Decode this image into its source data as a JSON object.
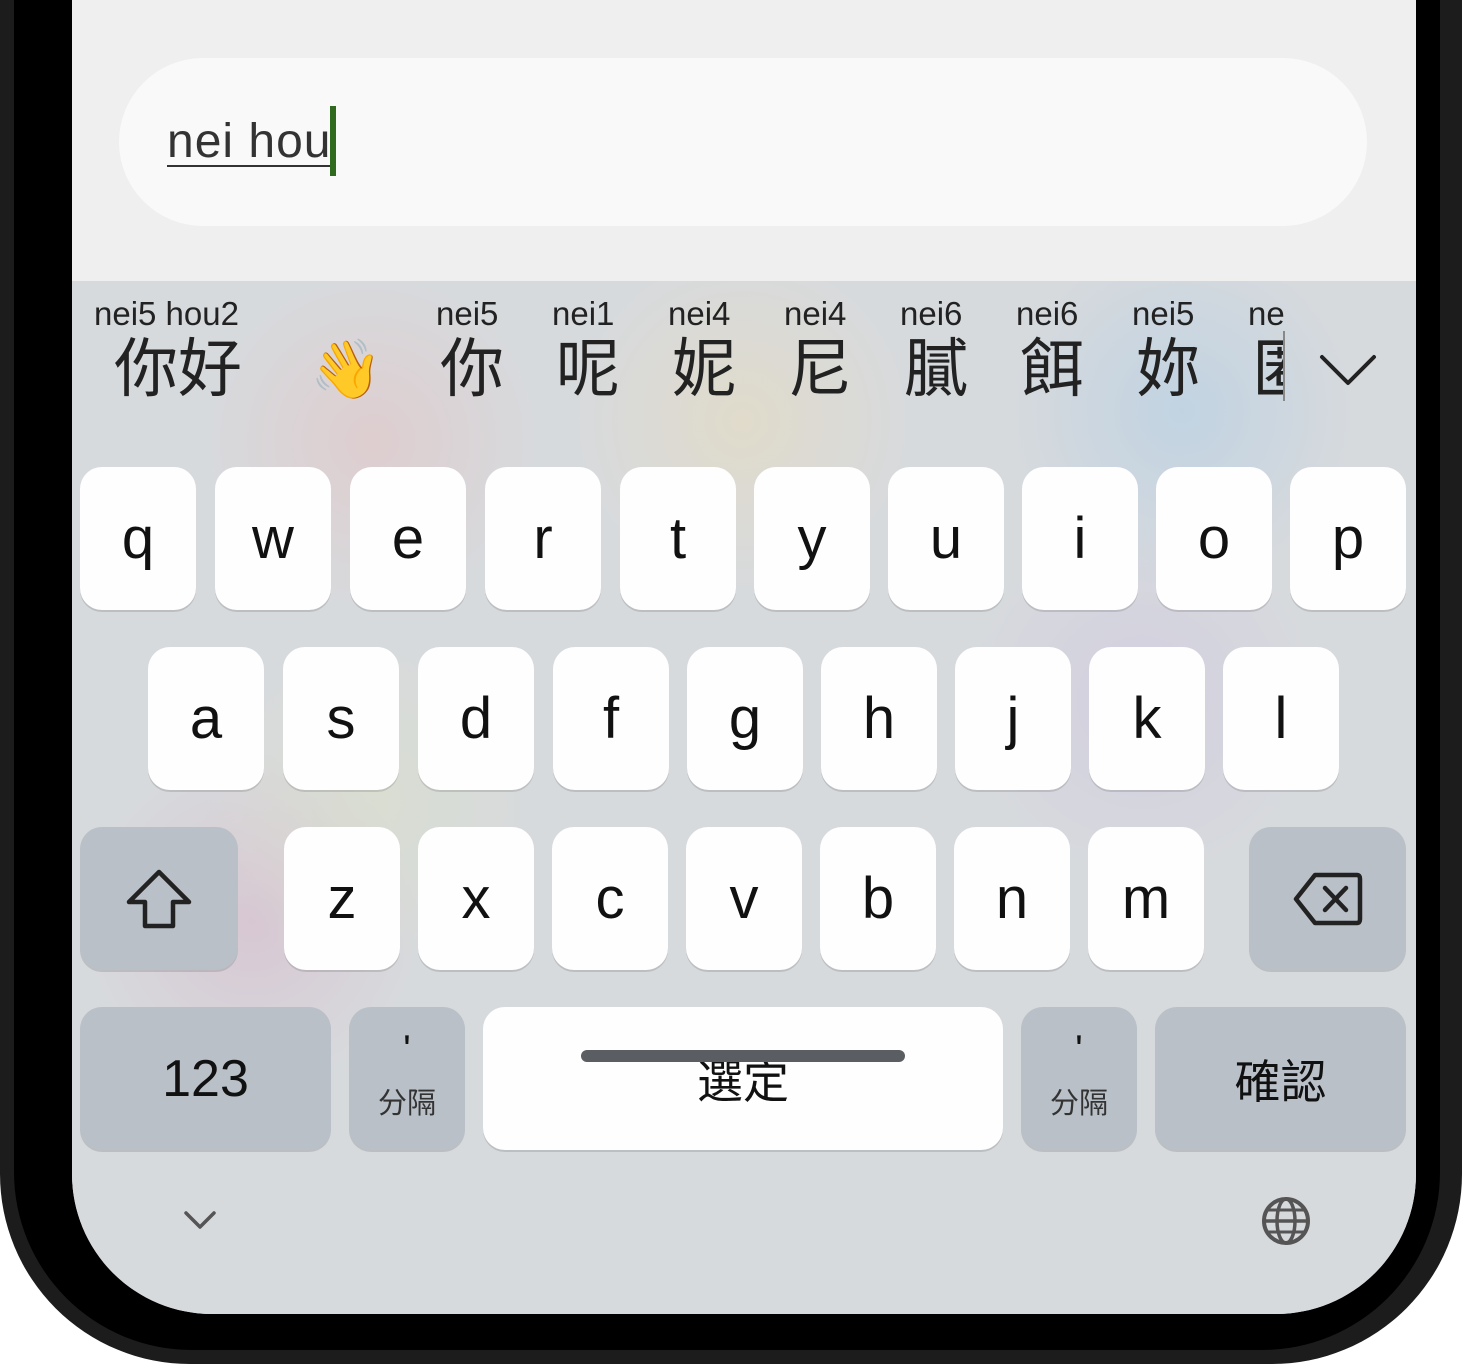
{
  "input": {
    "text": "nei hou"
  },
  "candidates": [
    {
      "pinyin": "nei5 hou2",
      "hanzi": "你好"
    },
    {
      "pinyin": "",
      "hanzi": "👋"
    },
    {
      "pinyin": "nei5",
      "hanzi": "你"
    },
    {
      "pinyin": "nei1",
      "hanzi": "呢"
    },
    {
      "pinyin": "nei4",
      "hanzi": "妮"
    },
    {
      "pinyin": "nei4",
      "hanzi": "尼"
    },
    {
      "pinyin": "nei6",
      "hanzi": "膩"
    },
    {
      "pinyin": "nei6",
      "hanzi": "餌"
    },
    {
      "pinyin": "nei5",
      "hanzi": "妳"
    },
    {
      "pinyin": "ne",
      "hanzi": "匿"
    }
  ],
  "keyboard": {
    "row1": [
      "q",
      "w",
      "e",
      "r",
      "t",
      "y",
      "u",
      "i",
      "o",
      "p"
    ],
    "row2": [
      "a",
      "s",
      "d",
      "f",
      "g",
      "h",
      "j",
      "k",
      "l"
    ],
    "row3": [
      "z",
      "x",
      "c",
      "v",
      "b",
      "n",
      "m"
    ],
    "numbers_label": "123",
    "apostrophe": "'",
    "separator_label": "分隔",
    "space_label": "選定",
    "confirm_label": "確認"
  },
  "icons": {
    "expand": "chevron-down-icon",
    "shift": "shift-icon",
    "backspace": "backspace-icon",
    "collapse": "chevron-down-icon",
    "language": "globe-icon"
  }
}
